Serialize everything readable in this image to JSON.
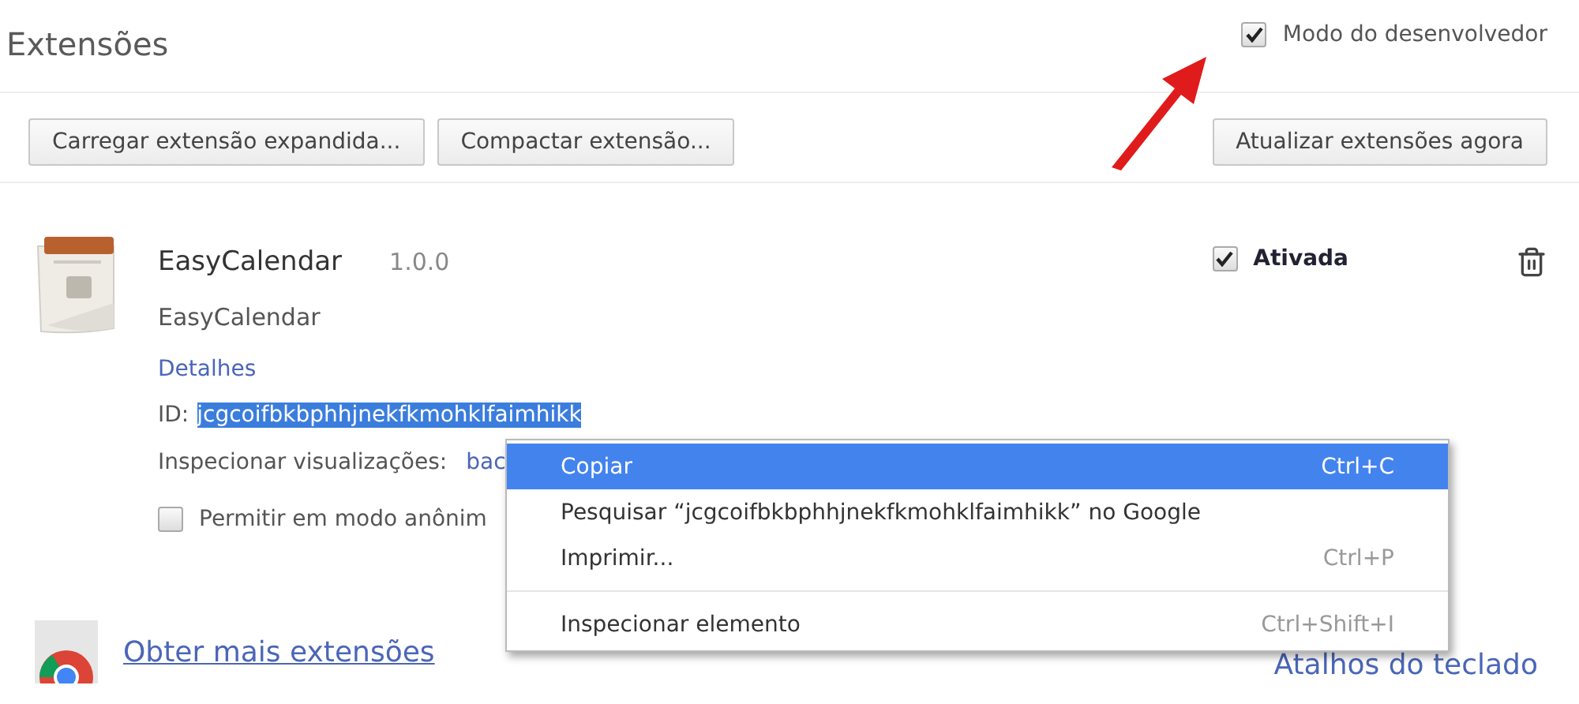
{
  "page": {
    "title": "Extensões"
  },
  "developer_mode": {
    "label": "Modo do desenvolvedor",
    "checked": true
  },
  "toolbar": {
    "buttons": [
      "Carregar extensão expandida...",
      "Compactar extensão..."
    ],
    "update_button": "Atualizar extensões agora"
  },
  "extensions": [
    {
      "name": "EasyCalendar",
      "version": "1.0.0",
      "description": "EasyCalendar",
      "details_link": "Detalhes",
      "id_label": "ID:",
      "id": "jcgcoifbkbphhjnekfkmohklfaimhikk",
      "id_selected": true,
      "inspect_label": "Inspecionar visualizações:",
      "inspect_link": "bac",
      "incognito": {
        "label": "Permitir em modo anônim",
        "checked": false
      },
      "enabled": {
        "label": "Ativada",
        "checked": true
      }
    }
  ],
  "footer": {
    "more_link": "Obter mais extensões",
    "shortcuts_link": "Atalhos do teclado"
  },
  "context_menu": {
    "items": [
      {
        "kind": "item",
        "label": "Copiar",
        "shortcut": "Ctrl+C",
        "selected": true
      },
      {
        "kind": "item",
        "label": "Pesquisar “jcgcoifbkbphhjnekfkmohklfaimhikk” no Google",
        "selected": false
      },
      {
        "kind": "item",
        "label": "Imprimir...",
        "shortcut": "Ctrl+P",
        "selected": false
      },
      {
        "kind": "separator"
      },
      {
        "kind": "item",
        "label": "Inspecionar elemento",
        "shortcut": "Ctrl+Shift+I",
        "selected": false
      }
    ]
  }
}
